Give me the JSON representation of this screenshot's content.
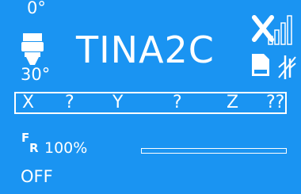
{
  "header": {
    "target_temp": "0°",
    "current_temp": "30°",
    "device_name": "TINA2C"
  },
  "axes": {
    "x_label": "X",
    "x_value": "?",
    "y_label": "Y",
    "y_value": "?",
    "z_label": "Z",
    "z_value": "??"
  },
  "feedrate": {
    "icon_text_top": "F",
    "icon_text_bottom": "R",
    "value": "100%"
  },
  "progress": {
    "fraction": 0
  },
  "status": {
    "text": "OFF"
  },
  "icons": {
    "nozzle": "nozzle-icon",
    "wifi": "wifi-disconnected-icon",
    "sd": "sd-card-icon",
    "usb": "usb-disconnected-icon"
  },
  "colors": {
    "background": "#1a94f2",
    "foreground": "#ffffff"
  }
}
